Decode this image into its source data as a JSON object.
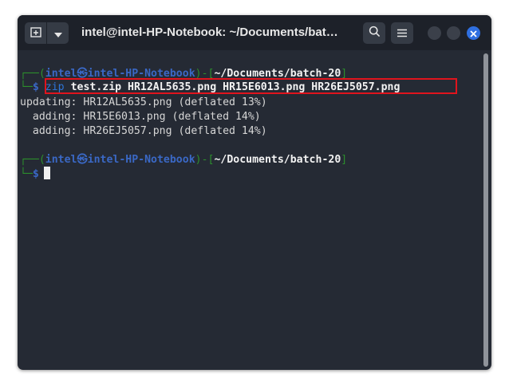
{
  "window": {
    "title": "intel@intel-HP-Notebook: ~/Documents/bat…",
    "icons": {
      "new_tab": "new-tab-icon",
      "menu_dropdown": "chevron-down-icon",
      "search": "search-icon",
      "hamburger": "hamburger-menu-icon",
      "minimize": "minimize-icon",
      "maximize": "maximize-icon",
      "close": "close-icon"
    }
  },
  "colors": {
    "terminal_bg": "#252a34",
    "titlebar_bg": "#1d2129",
    "prompt_green": "#2c8f2c",
    "prompt_blue": "#3a68c5",
    "command_blue": "#2e75d8",
    "highlight_red": "#e0141d",
    "close_blue": "#2f6fe0"
  },
  "prompt": {
    "top_left": "┌──(",
    "user": "intel",
    "at": "㉿",
    "host": "intel-HP-Notebook",
    "sep": ")-[",
    "path": "~/Documents/batch-20",
    "close": "]",
    "bottom_left": "└─",
    "symbol": "$"
  },
  "session": {
    "command_name": "zip",
    "command_args": "test.zip HR12AL5635.png HR15E6013.png HR26EJ5057.png",
    "output": [
      "updating: HR12AL5635.png (deflated 13%)",
      "  adding: HR15E6013.png (deflated 14%)",
      "  adding: HR26EJ5057.png (deflated 14%)"
    ]
  }
}
